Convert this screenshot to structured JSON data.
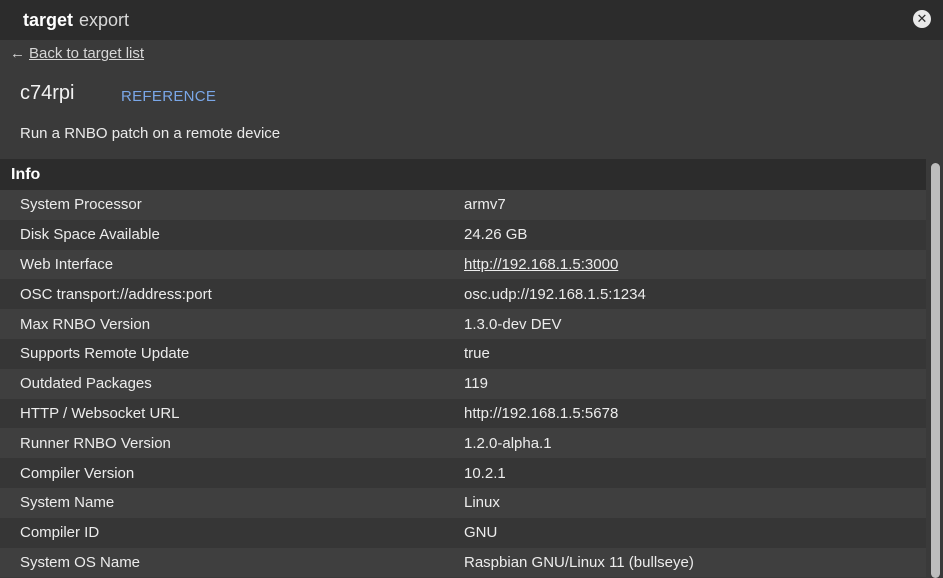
{
  "header": {
    "title_bold": "target",
    "title_light": "export",
    "close_symbol": "✕"
  },
  "nav": {
    "back_arrow": "←",
    "back_label": "Back to target list"
  },
  "target": {
    "name": "c74rpi",
    "reference_label": "REFERENCE",
    "description": "Run a RNBO patch on a remote device"
  },
  "info": {
    "section_title": "Info",
    "rows": [
      {
        "key": "System Processor",
        "value": "armv7"
      },
      {
        "key": "Disk Space Available",
        "value": "24.26 GB"
      },
      {
        "key": "Web Interface",
        "value": "http://192.168.1.5:3000"
      },
      {
        "key": "OSC transport://address:port",
        "value": "osc.udp://192.168.1.5:1234"
      },
      {
        "key": "Max RNBO Version",
        "value": "1.3.0-dev DEV"
      },
      {
        "key": "Supports Remote Update",
        "value": "true"
      },
      {
        "key": "Outdated Packages",
        "value": "119"
      },
      {
        "key": "HTTP / Websocket URL",
        "value": "http://192.168.1.5:5678"
      },
      {
        "key": "Runner RNBO Version",
        "value": "1.2.0-alpha.1"
      },
      {
        "key": "Compiler Version",
        "value": "10.2.1"
      },
      {
        "key": "System Name",
        "value": "Linux"
      },
      {
        "key": "Compiler ID",
        "value": "GNU"
      },
      {
        "key": "System OS Name",
        "value": "Raspbian GNU/Linux 11 (bullseye)"
      }
    ]
  },
  "colors": {
    "background": "#3a3a3a",
    "titlebar": "#2c2c2c",
    "accent_link": "#7aa7e8"
  }
}
